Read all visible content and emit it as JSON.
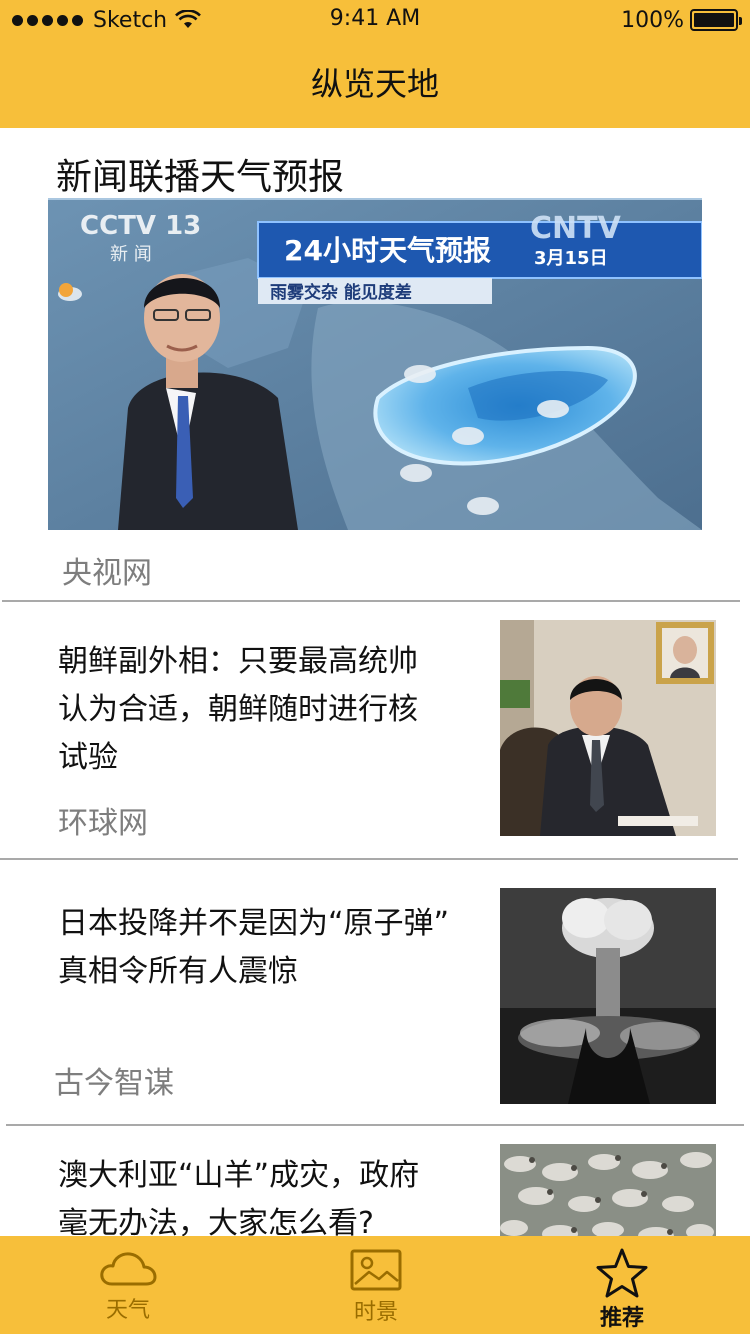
{
  "status_bar": {
    "carrier": "Sketch",
    "time": "9:41 AM",
    "battery": "100%"
  },
  "nav": {
    "title": "纵览天地"
  },
  "feature": {
    "title": "新闻联播天气预报",
    "source": "央视网",
    "image": {
      "channel": "CCTV 13",
      "channel_sub": "新 闻",
      "corner_logo": "CNTV",
      "banner_title": "24小时天气预报",
      "banner_date": "3月15日",
      "banner_sub": "雨雾交杂 能见度差"
    }
  },
  "articles": [
    {
      "title_lines": [
        "朝鲜副外相：只要最高统帅",
        "认为合适，朝鲜随时进行核",
        "试验"
      ],
      "source": "环球网"
    },
    {
      "title_lines": [
        "日本投降并不是因为“原子弹”",
        "真相令所有人震惊"
      ],
      "source": "古今智谋"
    },
    {
      "title_lines": [
        "澳大利亚“山羊”成灾，政府",
        "毫无办法，大家怎么看?"
      ],
      "source": ""
    }
  ],
  "tabbar": {
    "items": [
      {
        "label": "天气",
        "icon": "cloud-icon"
      },
      {
        "label": "时景",
        "icon": "image-icon"
      },
      {
        "label": "推荐",
        "icon": "star-icon"
      }
    ],
    "active": "推荐"
  },
  "colors": {
    "accent": "#f7bf3a",
    "source_text": "#7e7e7e",
    "divider": "#a9a9a9"
  }
}
